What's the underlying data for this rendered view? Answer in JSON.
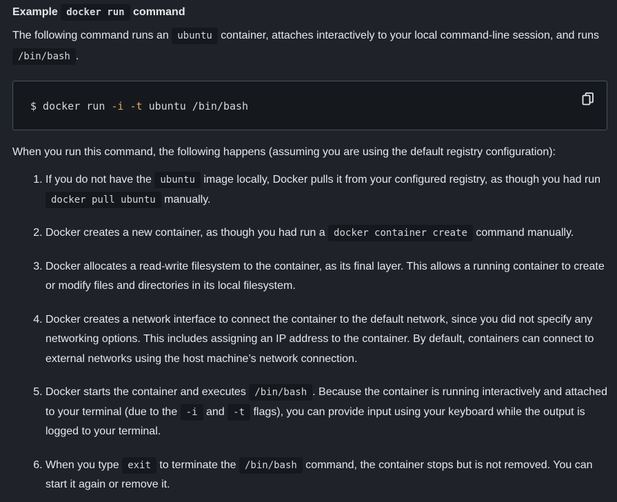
{
  "heading": {
    "prefix": "Example",
    "code": "docker run",
    "suffix": "command"
  },
  "intro": {
    "part1": "The following command runs an",
    "code1": "ubuntu",
    "part2": "container, attaches interactively to your local command-line session, and runs",
    "code2": "/bin/bash",
    "part3": "."
  },
  "codeblock": {
    "prompt": "$ docker run",
    "flag_i": "-i",
    "flag_t": "-t",
    "rest": "ubuntu /bin/bash",
    "copy_icon": "copy-icon"
  },
  "after_text": "When you run this command, the following happens (assuming you are using the default registry configuration):",
  "steps": [
    {
      "p1": "If you do not have the",
      "c1": "ubuntu",
      "p2": "image locally, Docker pulls it from your configured registry, as though you had run",
      "c2": "docker pull ubuntu",
      "p3": "manually."
    },
    {
      "p1": "Docker creates a new container, as though you had run a",
      "c1": "docker container create",
      "p2": "command manually."
    },
    {
      "p1": "Docker allocates a read-write filesystem to the container, as its final layer. This allows a running container to create or modify files and directories in its local filesystem."
    },
    {
      "p1": "Docker creates a network interface to connect the container to the default network, since you did not specify any networking options. This includes assigning an IP address to the container. By default, containers can connect to external networks using the host machine’s network connection."
    },
    {
      "p1": "Docker starts the container and executes",
      "c1": "/bin/bash",
      "p2": ". Because the container is running interactively and attached to your terminal (due to the",
      "c2": "-i",
      "p3": "and",
      "c3": "-t",
      "p4": "flags), you can provide input using your keyboard while the output is logged to your terminal."
    },
    {
      "p1": "When you type",
      "c1": "exit",
      "p2": "to terminate the",
      "c2": "/bin/bash",
      "p3": "command, the container stops but is not removed. You can start it again or remove it."
    }
  ]
}
